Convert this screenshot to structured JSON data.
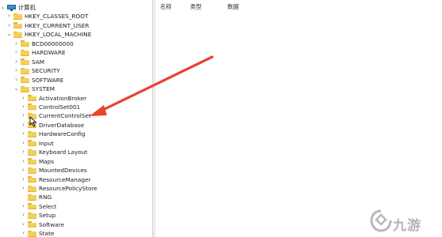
{
  "tree": {
    "root_label": "计算机",
    "items": [
      {
        "label": "HKEY_CLASSES_ROOT",
        "indent": 1
      },
      {
        "label": "HKEY_CURRENT_USER",
        "indent": 1
      },
      {
        "label": "HKEY_LOCAL_MACHINE",
        "indent": 1,
        "expanded": true
      },
      {
        "label": "BCD00000000",
        "indent": 2
      },
      {
        "label": "HARDWARE",
        "indent": 2
      },
      {
        "label": "SAM",
        "indent": 2
      },
      {
        "label": "SECURITY",
        "indent": 2
      },
      {
        "label": "SOFTWARE",
        "indent": 2
      },
      {
        "label": "SYSTEM",
        "indent": 2,
        "expanded": true
      },
      {
        "label": "ActivationBroker",
        "indent": 3
      },
      {
        "label": "ControlSet001",
        "indent": 3
      },
      {
        "label": "CurrentControlSet",
        "indent": 3
      },
      {
        "label": "DriverDatabase",
        "indent": 3
      },
      {
        "label": "HardwareConfig",
        "indent": 3
      },
      {
        "label": "Input",
        "indent": 3
      },
      {
        "label": "Keyboard Layout",
        "indent": 3
      },
      {
        "label": "Maps",
        "indent": 3
      },
      {
        "label": "MountedDevices",
        "indent": 3
      },
      {
        "label": "ResourceManager",
        "indent": 3
      },
      {
        "label": "ResourcePolicyStore",
        "indent": 3
      },
      {
        "label": "RNG",
        "indent": 3,
        "leaf": true
      },
      {
        "label": "Select",
        "indent": 3
      },
      {
        "label": "Setup",
        "indent": 3
      },
      {
        "label": "Software",
        "indent": 3
      },
      {
        "label": "State",
        "indent": 3
      }
    ]
  },
  "list": {
    "columns": [
      "名称",
      "类型",
      "数据"
    ]
  },
  "watermark": {
    "text": "九游"
  },
  "colors": {
    "arrow": "#e8432f",
    "folder": "#f5cf57"
  }
}
